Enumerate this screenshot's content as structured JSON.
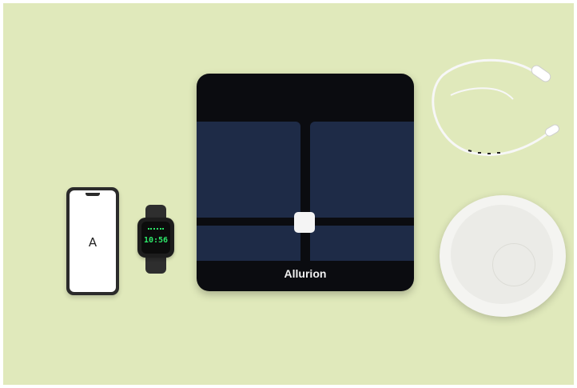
{
  "phone": {
    "letter": "A"
  },
  "watch": {
    "time": "10:56"
  },
  "scale": {
    "brand": "Allurion"
  },
  "colors": {
    "background": "#e0e9bb",
    "scale_body": "#0b0c10",
    "scale_panel": "#1e2b47",
    "watch_display": "#2ee86a"
  }
}
